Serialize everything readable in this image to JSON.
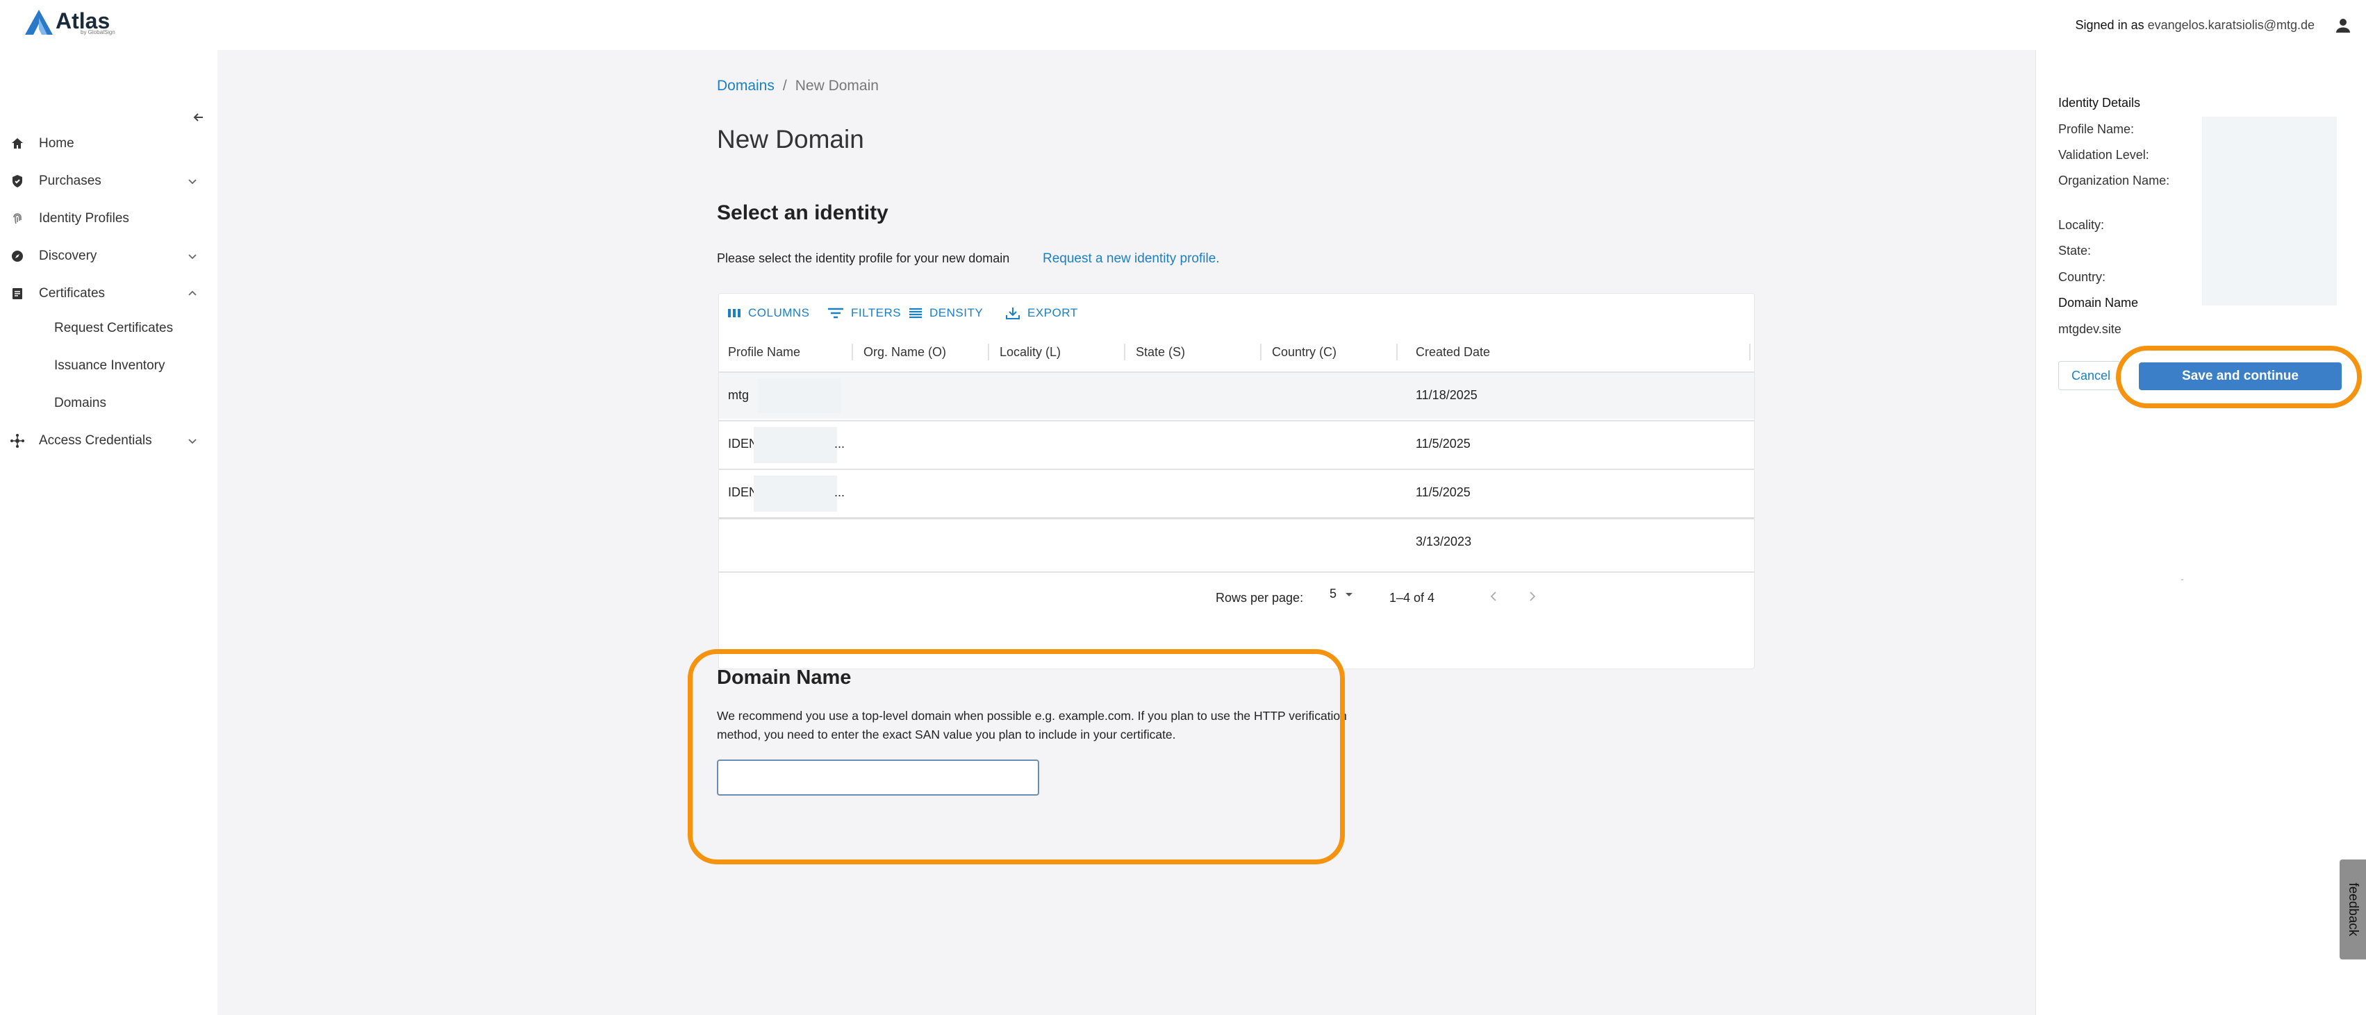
{
  "header": {
    "logo_text": "Atlas",
    "logo_sub": "by GlobalSign",
    "signed_in_label": "Signed in as",
    "email": "evangelos.karatsiolis@mtg.de"
  },
  "sidebar": {
    "items": [
      {
        "label": "Home",
        "icon": "home-icon"
      },
      {
        "label": "Purchases",
        "icon": "shield-icon",
        "expand": "chevron-down"
      },
      {
        "label": "Identity Profiles",
        "icon": "fingerprint-icon"
      },
      {
        "label": "Discovery",
        "icon": "compass-icon",
        "expand": "chevron-down"
      },
      {
        "label": "Certificates",
        "icon": "document-icon",
        "expand": "chevron-up"
      },
      {
        "label": "Access Credentials",
        "icon": "network-icon",
        "expand": "chevron-down"
      }
    ],
    "sub_items": [
      "Request Certificates",
      "Issuance Inventory",
      "Domains"
    ]
  },
  "breadcrumb": {
    "root": "Domains",
    "separator": "/",
    "current": "New Domain"
  },
  "page_title": "New Domain",
  "identity": {
    "title": "Select an identity",
    "description": "Please select the identity profile for your new domain",
    "request_link": "Request a new identity profile."
  },
  "grid": {
    "toolbar": [
      "COLUMNS",
      "FILTERS",
      "DENSITY",
      "EXPORT"
    ],
    "columns": [
      "Profile Name",
      "Org. Name (O)",
      "Locality (L)",
      "State (S)",
      "Country (C)",
      "Created Date"
    ],
    "rows": [
      {
        "profile": "mtg",
        "org_suffix": "",
        "date": "11/18/2025"
      },
      {
        "profile": "IDEN",
        "org_suffix": "...",
        "date": "11/5/2025"
      },
      {
        "profile": "IDEN",
        "org_suffix": "...",
        "date": "11/5/2025"
      },
      {
        "profile": "",
        "org_suffix": "",
        "date": "3/13/2023"
      }
    ],
    "rows_per_page_label": "Rows per page:",
    "rows_per_page": "5",
    "range": "1–4 of 4"
  },
  "domain": {
    "title": "Domain Name",
    "description": "We recommend you use a top-level domain when possible e.g. example.com. If you plan to use the HTTP verification method, you need to enter the exact SAN value you plan to include in your certificate.",
    "input_value": ""
  },
  "panel": {
    "title": "Identity Details",
    "labels": [
      "Profile Name:",
      "Validation Level:",
      "Organization Name:",
      "Locality:",
      "State:",
      "Country:"
    ],
    "domain_label": "Domain Name",
    "domain_value": "mtgdev.site",
    "cancel": "Cancel",
    "save": "Save and continue"
  },
  "feedback": "feedback",
  "colors": {
    "accent": "#3b7fc9",
    "link": "#1b7fc4",
    "highlight": "#f5930f"
  }
}
